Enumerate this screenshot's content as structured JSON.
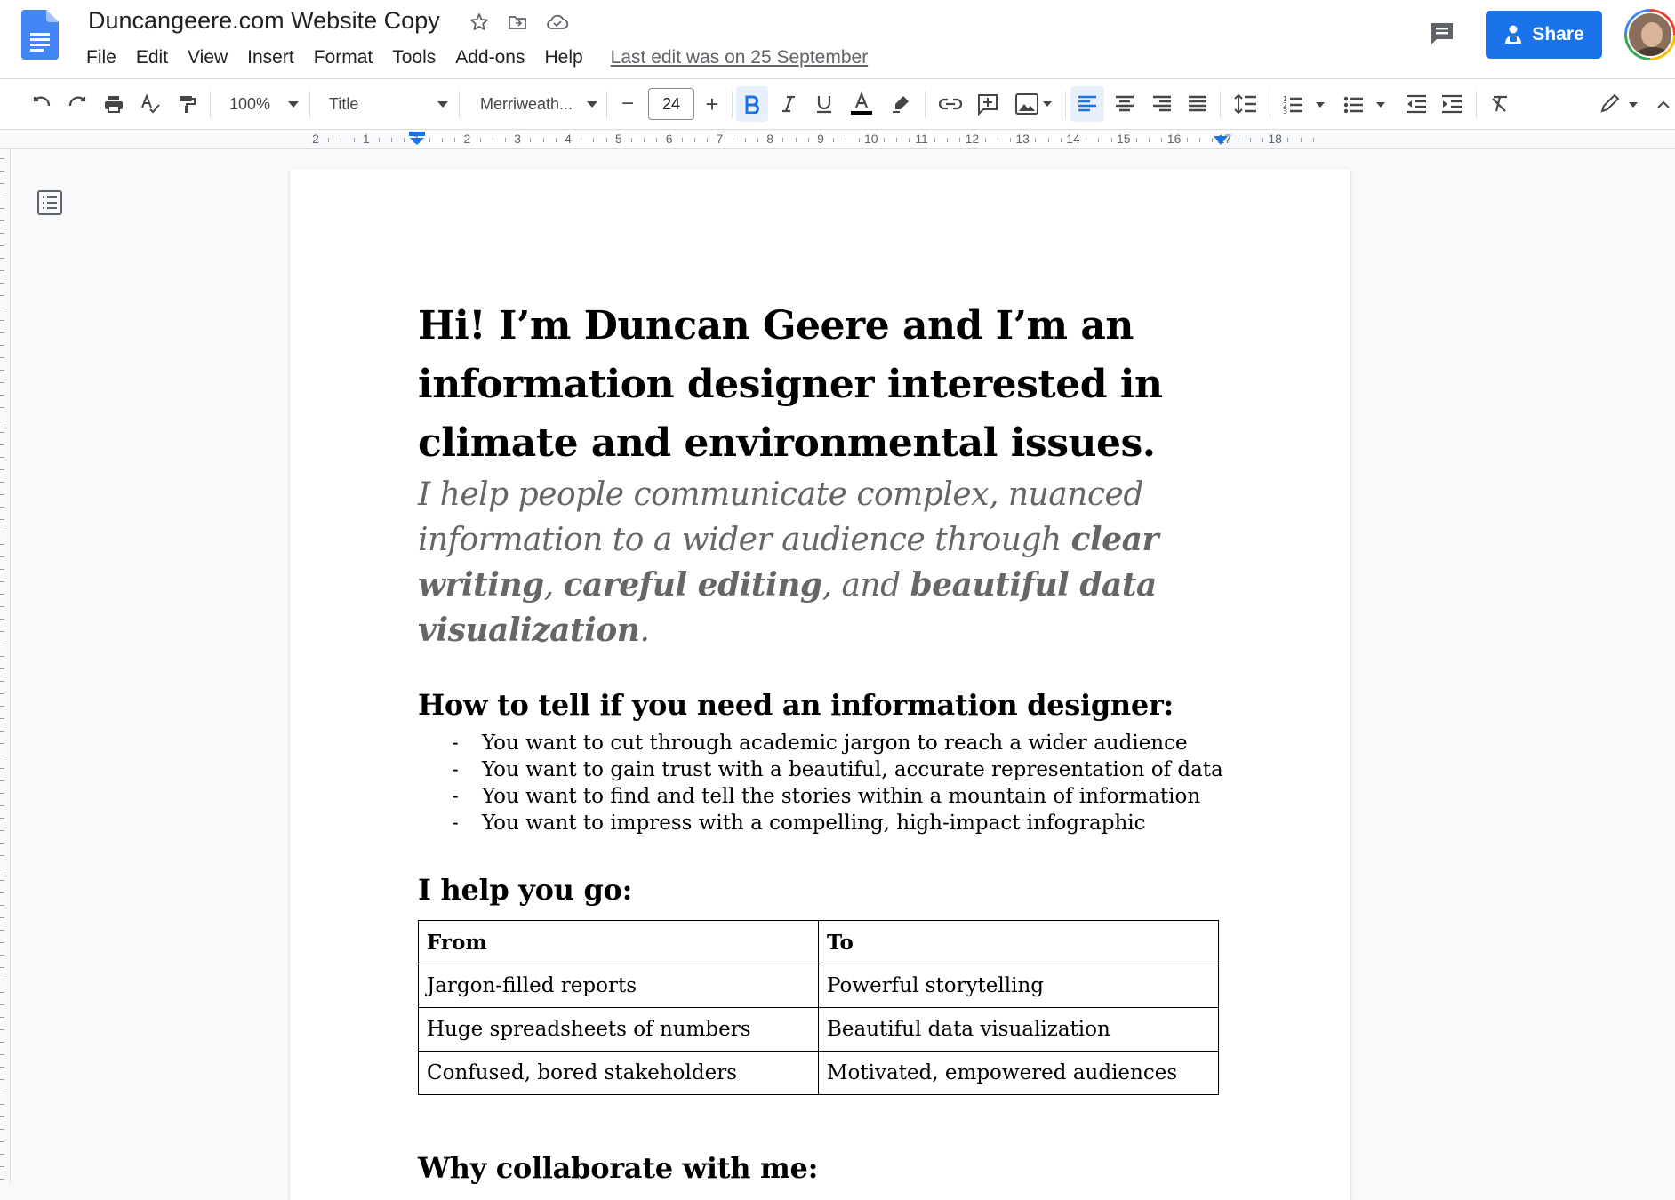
{
  "doc_title": "Duncangeere.com Website Copy",
  "menu": [
    "File",
    "Edit",
    "View",
    "Insert",
    "Format",
    "Tools",
    "Add-ons",
    "Help"
  ],
  "last_edit": "Last edit was on 25 September",
  "share_label": "Share",
  "toolbar": {
    "zoom": "100%",
    "style": "Title",
    "font": "Merriweath...",
    "font_size": "24",
    "minus": "−",
    "plus": "+"
  },
  "ruler_labels": [
    "2",
    "1",
    "1",
    "2",
    "3",
    "4",
    "5",
    "6",
    "7",
    "8",
    "9",
    "10",
    "11",
    "12",
    "13",
    "14",
    "15",
    "16",
    "17",
    "18"
  ],
  "document": {
    "title": "Hi! I’m Duncan Geere and I’m an information designer interested in climate and environmental issues.",
    "subtitle_parts": [
      {
        "text": "I help people communicate complex, nuanced information to a wider audience through ",
        "bold": false
      },
      {
        "text": "clear writing",
        "bold": true
      },
      {
        "text": ", ",
        "bold": false
      },
      {
        "text": "careful editing",
        "bold": true
      },
      {
        "text": ", and ",
        "bold": false
      },
      {
        "text": "beautiful data visualization",
        "bold": true
      },
      {
        "text": ".",
        "bold": false
      }
    ],
    "section1_heading": "How to tell if you need an information designer:",
    "bullets": [
      "You want to cut through academic jargon to reach a wider audience",
      "You want to gain trust with a beautiful, accurate representation of data",
      "You want to find and tell the stories within a mountain of information",
      "You want to impress with a compelling, high-impact infographic"
    ],
    "section2_heading": "I help you go:",
    "table": {
      "headers": [
        "From",
        "To"
      ],
      "rows": [
        [
          "Jargon-filled reports",
          "Powerful storytelling"
        ],
        [
          "Huge spreadsheets of numbers",
          "Beautiful data visualization"
        ],
        [
          "Confused, bored stakeholders",
          "Motivated, empowered audiences"
        ]
      ]
    },
    "section3_heading": "Why collaborate with me:"
  },
  "colors": {
    "accent": "#1a73e8",
    "docs_blue": "#4285f4",
    "subtitle_gray": "#666666"
  }
}
